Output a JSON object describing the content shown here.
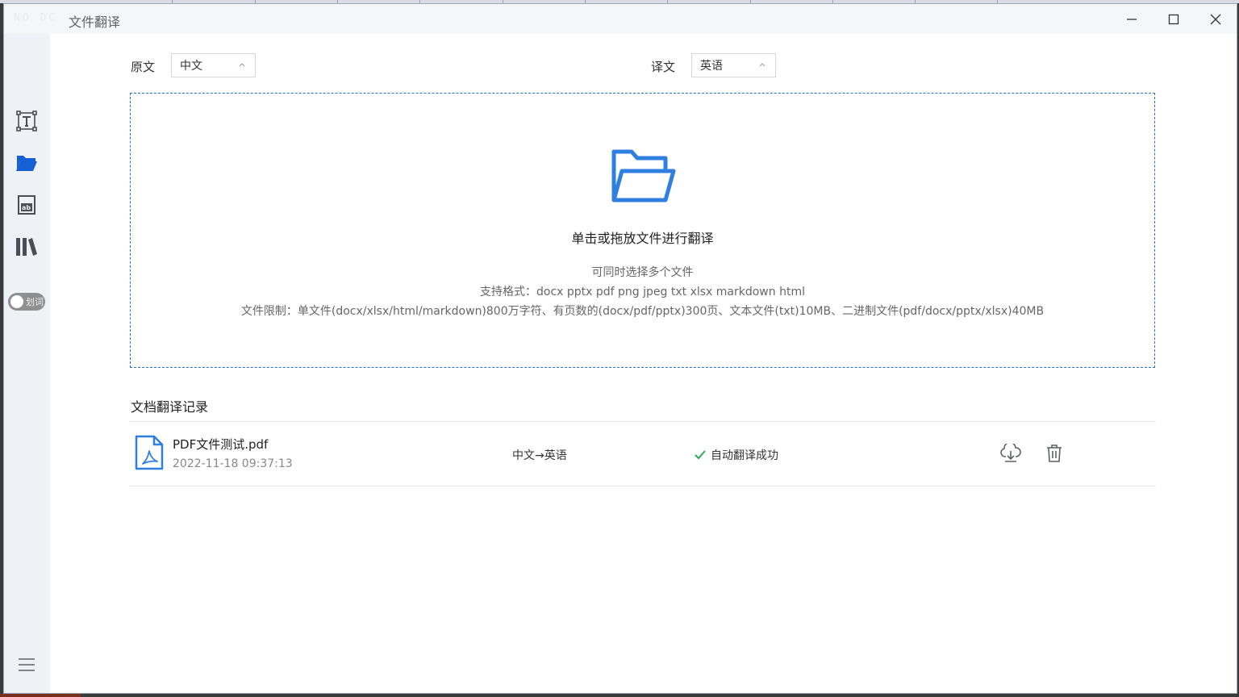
{
  "window": {
    "logo_text": "NO DC",
    "title": "文件翻译",
    "minimize_icon": "minimize-icon",
    "maximize_icon": "maximize-icon",
    "close_icon": "close-icon"
  },
  "sidebar": {
    "items": [
      {
        "icon": "text-translate-icon",
        "active": false
      },
      {
        "icon": "folder-open-icon",
        "active": true
      },
      {
        "icon": "image-translate-icon",
        "active": false
      },
      {
        "icon": "library-icon",
        "active": false
      }
    ],
    "toggle_label": "划词",
    "menu_icon": "hamburger-menu-icon"
  },
  "languages": {
    "source_label": "原文",
    "source_value": "中文",
    "target_label": "译文",
    "target_value": "英语"
  },
  "dropzone": {
    "title": "单击或拖放文件进行翻译",
    "line1": "可同时选择多个文件",
    "line2": "支持格式：docx pptx pdf png jpeg txt xlsx markdown html",
    "line3": "文件限制：单文件(docx/xlsx/html/markdown)800万字符、有页数的(docx/pdf/pptx)300页、文本文件(txt)10MB、二进制文件(pdf/docx/pptx/xlsx)40MB"
  },
  "records": {
    "title": "文档翻译记录",
    "items": [
      {
        "file_name": "PDF文件测试.pdf",
        "time": "2022-11-18 09:37:13",
        "lang_pair": "中文→英语",
        "status": "自动翻译成功"
      }
    ]
  },
  "colors": {
    "accent": "#2f7fe0",
    "success": "#2fa84f",
    "sidebar_bg": "#eef1f5",
    "dashed_border": "#2c6fd1"
  }
}
